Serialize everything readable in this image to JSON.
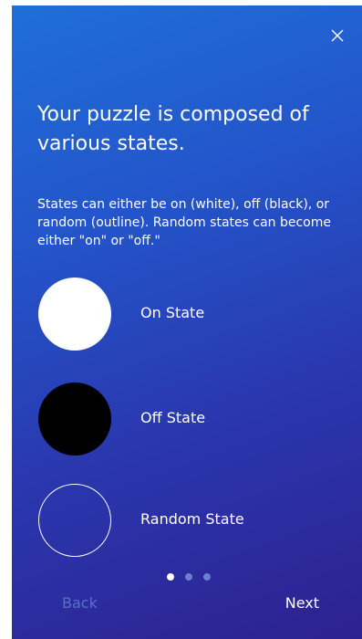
{
  "modal": {
    "close_icon": "close-icon",
    "title": "Your puzzle is composed of various states.",
    "description": "States can either be on (white), off (black), or random (outline).  Random states can become either \"on\" or \"off.\"",
    "states": [
      {
        "label": "On State",
        "style": "filled-white"
      },
      {
        "label": "Off State",
        "style": "filled-black"
      },
      {
        "label": "Random State",
        "style": "outline-white"
      }
    ],
    "pagination": {
      "current": 1,
      "total": 3
    },
    "back_label": "Back",
    "next_label": "Next"
  },
  "colors": {
    "gradient_top": "#1f6fd8",
    "gradient_bottom": "#2d218f",
    "disabled_text": "#5c6fc6",
    "inactive_dot": "#6f7fcf"
  }
}
